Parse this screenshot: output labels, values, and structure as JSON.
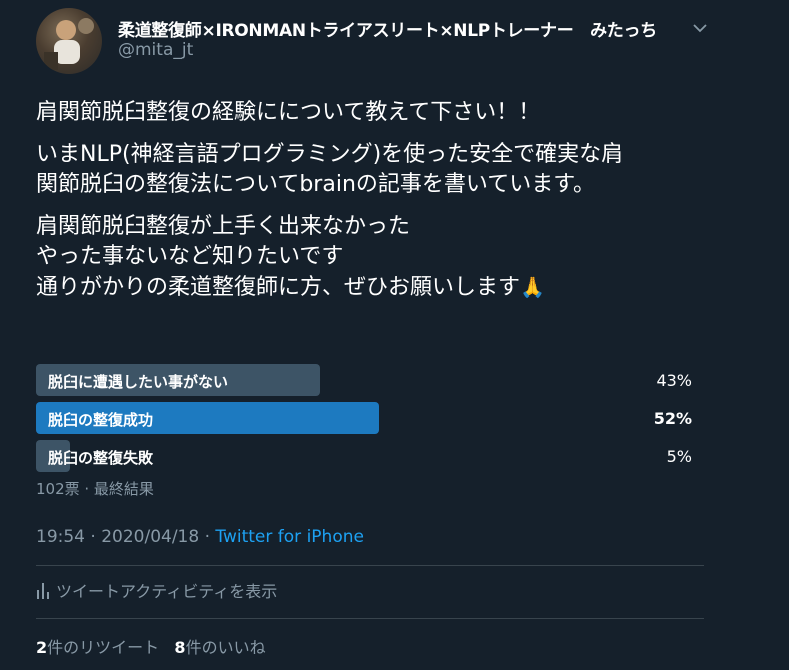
{
  "author": {
    "display_name": "柔道整復師×IRONMANトライアスリート×NLPトレーナー　みたっち",
    "handle": "@mita_jt",
    "avatar_icon": "user-avatar-photo"
  },
  "tweet": {
    "paragraphs": [
      "肩関節脱臼整復の経験にについて教えて下さい！！",
      "いまNLP(神経言語プログラミング)を使った安全で確実な肩\n関節脱臼の整復法についてbrainの記事を書いています。",
      "肩関節脱臼整復が上手く出来なかった\nやった事ないなど知りたいです\n通りがかりの柔道整復師に方、ぜひお願いします"
    ],
    "emoji": "🙏"
  },
  "poll": {
    "options": [
      {
        "label": "脱臼に遭遇したい事がない",
        "percent": 43,
        "percent_text": "43%",
        "winner": false
      },
      {
        "label": "脱臼の整復成功",
        "percent": 52,
        "percent_text": "52%",
        "winner": true
      },
      {
        "label": "脱臼の整復失敗",
        "percent": 5,
        "percent_text": "5%",
        "winner": false
      }
    ],
    "meta": "102票 · 最終結果"
  },
  "timestamp": {
    "time_date": "19:54 · 2020/04/18 · ",
    "source": "Twitter for iPhone"
  },
  "activity": {
    "label": "ツイートアクティビティを表示",
    "icon": "bar-chart-icon"
  },
  "stats": {
    "retweets_count": "2",
    "retweets_label": "件のリツイート",
    "likes_count": "8",
    "likes_label": "件のいいね"
  },
  "colors": {
    "background": "#15202b",
    "secondary_text": "#8899a6",
    "accent": "#1da1f2",
    "poll_bar": "#3d5466",
    "poll_bar_winner": "#1d7ac0"
  }
}
